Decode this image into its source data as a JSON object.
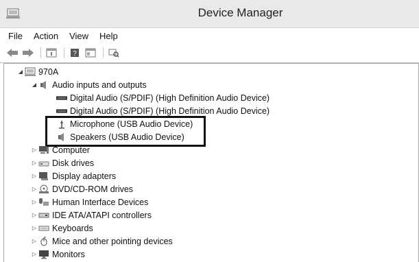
{
  "window": {
    "title": "Device Manager"
  },
  "menu": {
    "file": "File",
    "action": "Action",
    "view": "View",
    "help": "Help"
  },
  "toolbar": {
    "buttons": [
      "back-arrow-icon",
      "forward-arrow-icon",
      "properties-icon",
      "help-icon",
      "console-tree-icon",
      "scan-hardware-icon"
    ]
  },
  "tree": {
    "root": "970A",
    "audio": {
      "label": "Audio inputs and outputs",
      "children": [
        "Digital Audio (S/PDIF) (High Definition Audio Device)",
        "Digital Audio (S/PDIF) (High Definition Audio Device)",
        "Microphone (USB Audio Device)",
        "Speakers (USB Audio Device)"
      ]
    },
    "categories": [
      "Computer",
      "Disk drives",
      "Display adapters",
      "DVD/CD-ROM drives",
      "Human Interface Devices",
      "IDE ATA/ATAPI controllers",
      "Keyboards",
      "Mice and other pointing devices",
      "Monitors"
    ]
  }
}
